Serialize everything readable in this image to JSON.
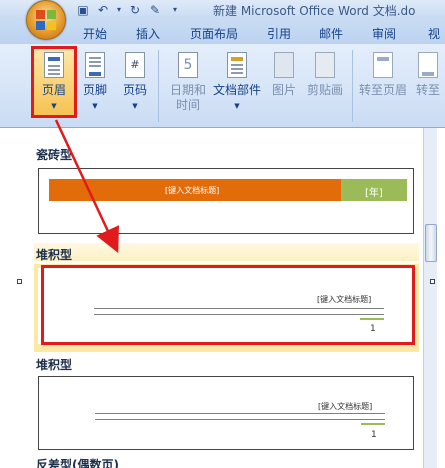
{
  "window": {
    "title": "新建 Microsoft Office Word 文档.do"
  },
  "tabs": [
    {
      "label": "开始"
    },
    {
      "label": "插入"
    },
    {
      "label": "页面布局"
    },
    {
      "label": "引用"
    },
    {
      "label": "邮件"
    },
    {
      "label": "审阅"
    },
    {
      "label": "视"
    }
  ],
  "ribbon": {
    "header": "页眉",
    "footer": "页脚",
    "page_number": "页码",
    "datetime_l1": "日期和",
    "datetime_l2": "时间",
    "doc_parts": "文档部件",
    "picture": "图片",
    "clipart": "剪贴画",
    "goto_header": "转至页眉",
    "goto_footer": "转至",
    "calendar_number": "5"
  },
  "gallery": {
    "sections": [
      {
        "title": "瓷砖型",
        "placeholder_title": "[键入文档标题]",
        "placeholder_year": "[年]"
      },
      {
        "title": "堆积型",
        "placeholder_title": "[键入文档标题]",
        "page_number": "1"
      },
      {
        "title": "堆积型",
        "placeholder_title": "[键入文档标题]",
        "page_number": "1"
      },
      {
        "title": "反差型(偶数页)"
      }
    ]
  },
  "colors": {
    "accent_red": "#e11b1b",
    "orange": "#e36c0a",
    "green": "#9bbb59",
    "selection": "#fde8a6"
  }
}
